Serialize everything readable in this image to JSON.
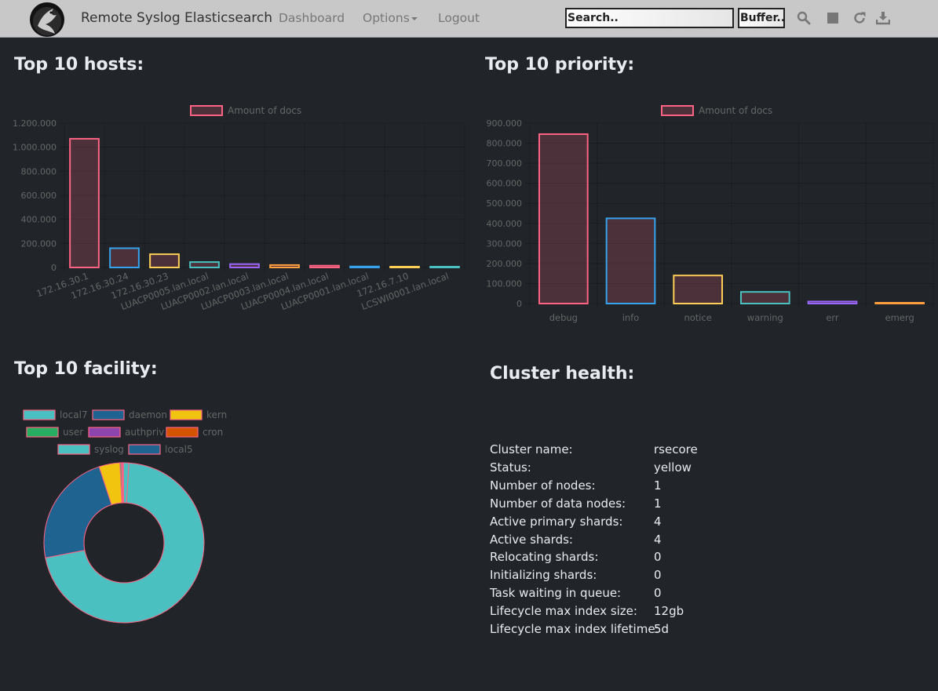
{
  "app": {
    "title": "Remote Syslog Elasticsearch"
  },
  "nav": {
    "dashboard": "Dashboard",
    "options": "Options",
    "logout": "Logout",
    "search_placeholder": "Search..",
    "buffer_label": "Buffer..",
    "icons": [
      "search-icon",
      "stop-icon",
      "refresh-icon",
      "download-icon"
    ]
  },
  "sections": {
    "hosts_title": "Top 10 hosts:",
    "priority_title": "Top 10 priority:",
    "facility_title": "Top 10 facility:",
    "health_title": "Cluster health:"
  },
  "chart_data": [
    {
      "type": "bar",
      "title": "Top 10 hosts:",
      "legend": [
        "Amount of docs"
      ],
      "legend_position": "top",
      "categories": [
        "172.16.30.1",
        "172.16.30.24",
        "172.16.30.23",
        "LUACP0005.lan.local",
        "LUACP0002.lan.local",
        "LUACP0003.lan.local",
        "LUACP0004.lan.local",
        "LUACP0001.lan.local",
        "172.16.7.10",
        "LCSWI0001.lan.local"
      ],
      "values": [
        1070000,
        160000,
        110000,
        45000,
        28000,
        20000,
        15000,
        8000,
        3000,
        2000
      ],
      "bar_colors": [
        "#ff6384",
        "#36a2eb",
        "#ffce56",
        "#4bc0c0",
        "#9966ff",
        "#ff9f40",
        "#ff6384",
        "#36a2eb",
        "#ffce56",
        "#4bc0c0"
      ],
      "yticks": [
        "0",
        "200.000",
        "400.000",
        "600.000",
        "800.000",
        "1.000.000",
        "1.200.000"
      ],
      "ylim": [
        0,
        1200000
      ],
      "grid": true
    },
    {
      "type": "bar",
      "title": "Top 10 priority:",
      "legend": [
        "Amount of docs"
      ],
      "legend_position": "top",
      "categories": [
        "debug",
        "info",
        "notice",
        "warning",
        "err",
        "emerg"
      ],
      "values": [
        845000,
        425000,
        140000,
        58000,
        10000,
        2000
      ],
      "bar_colors": [
        "#ff6384",
        "#36a2eb",
        "#ffce56",
        "#4bc0c0",
        "#9966ff",
        "#ff9f40"
      ],
      "yticks": [
        "0",
        "100.000",
        "200.000",
        "300.000",
        "400.000",
        "500.000",
        "600.000",
        "700.000",
        "800.000",
        "900.000"
      ],
      "ylim": [
        0,
        900000
      ],
      "grid": true
    },
    {
      "type": "pie",
      "title": "Top 10 facility:",
      "legend_position": "top",
      "labels": [
        "local7",
        "daemon",
        "kern",
        "user",
        "authpriv",
        "cron",
        "syslog",
        "local5"
      ],
      "values": [
        71,
        23,
        4.2,
        0.3,
        0.2,
        0.1,
        1.1,
        0.1
      ],
      "colors": [
        "#4bc0c0",
        "#1f6391",
        "#f1c40f",
        "#27ae60",
        "#8e44ad",
        "#d35400",
        "#4bc0c0",
        "#1f6391"
      ]
    }
  ],
  "health": {
    "rows": [
      {
        "k": "Cluster name:",
        "v": "rsecore"
      },
      {
        "k": "Status:",
        "v": "yellow"
      },
      {
        "k": "Number of nodes:",
        "v": "1"
      },
      {
        "k": "Number of data nodes:",
        "v": "1"
      },
      {
        "k": "Active primary shards:",
        "v": "4"
      },
      {
        "k": "Active shards:",
        "v": "4"
      },
      {
        "k": "Relocating shards:",
        "v": "0"
      },
      {
        "k": "Initializing shards:",
        "v": "0"
      },
      {
        "k": "Task waiting in queue:",
        "v": "0"
      },
      {
        "k": "Lifecycle max index size:",
        "v": "12gb"
      },
      {
        "k": "Lifecycle max index lifetime:",
        "v": "5d"
      }
    ]
  }
}
